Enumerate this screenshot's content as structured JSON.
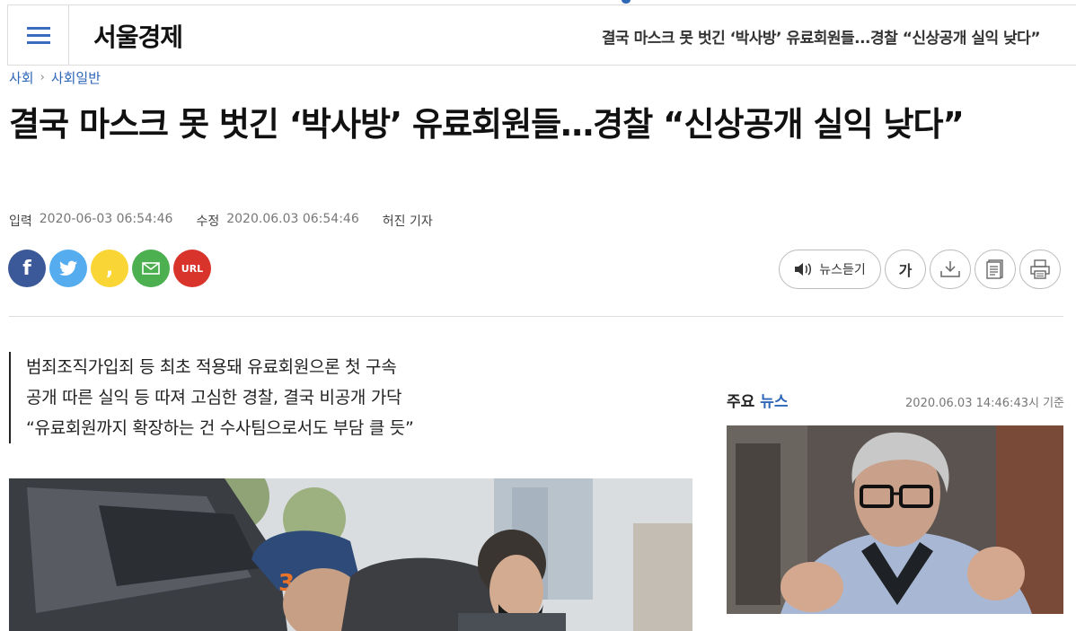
{
  "header": {
    "logo": "서울경제",
    "article_title": "결국 마스크 못 벗긴 ‘박사방’ 유료회원들...경찰 “신상공개 실익 낮다”"
  },
  "breadcrumb": {
    "section": "사회",
    "subsection": "사회일반"
  },
  "article": {
    "headline": "결국 마스크 못 벗긴 ‘박사방’ 유료회원들…경찰 “신상공개 실익 낮다”",
    "meta": {
      "published_label": "입력",
      "published_value": "2020-06-03 06:54:46",
      "modified_label": "수정",
      "modified_value": "2020.06.03 06:54:46",
      "author": "허진 기자"
    },
    "summary": [
      "범죄조직가입죄 등 최초 적용돼 유료회원으론 첫 구속",
      "공개 따른 실익 등 따져 고심한 경찰, 결국 비공개 가닥",
      "“유료회원까지 확장하는 건 수사팀으로서도 부담 클 듯”"
    ]
  },
  "share": {
    "facebook": "f",
    "twitter_icon": "twitter-bird-icon",
    "kakao": ",",
    "mail_icon": "mail-icon",
    "url": "URL"
  },
  "tools": {
    "listen_label": "뉴스듣기",
    "font_label": "가"
  },
  "sidebar": {
    "title_main": "주요",
    "title_accent": "뉴스",
    "timestamp": "2020.06.03 14:46:43시 기준"
  },
  "colors": {
    "accent": "#2e66b8",
    "facebook": "#3b5998",
    "twitter": "#55acee",
    "kakao": "#f9d635",
    "mail": "#4caf50",
    "url": "#d9342b"
  }
}
